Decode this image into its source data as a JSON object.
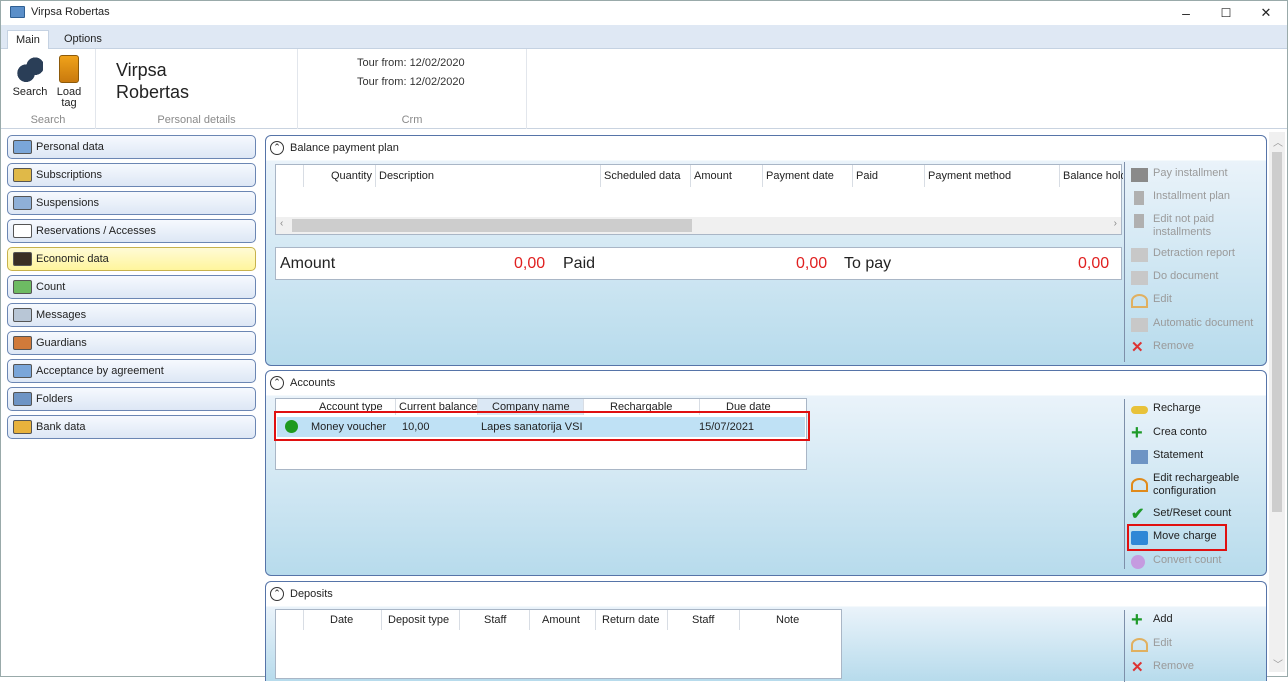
{
  "window": {
    "title": "Virpsa Robertas",
    "minimize": "–",
    "maximize": "☐",
    "close": "✕"
  },
  "tabs": [
    "Main",
    "Options"
  ],
  "ribbon": {
    "search_label": "Search",
    "load_tag_label": "Load tag",
    "search_group": "Search",
    "person_first": "Virpsa",
    "person_last": "Robertas",
    "personal_group": "Personal details",
    "tour_1": "Tour from: 12/02/2020",
    "tour_2": "Tour from: 12/02/2020",
    "crm_group": "Crm"
  },
  "nav": [
    {
      "label": "Personal data",
      "icon": "id-card-icon",
      "color": "#7aa6d9"
    },
    {
      "label": "Subscriptions",
      "icon": "tickets-icon",
      "color": "#e0b948"
    },
    {
      "label": "Suspensions",
      "icon": "pause-card-icon",
      "color": "#8fb0d8"
    },
    {
      "label": "Reservations / Accesses",
      "icon": "checklist-icon",
      "color": "#ffffff"
    },
    {
      "label": "Economic data",
      "icon": "wallet-icon",
      "color": "#3a2f24"
    },
    {
      "label": "Count",
      "icon": "money-icon",
      "color": "#6dbb63"
    },
    {
      "label": "Messages",
      "icon": "message-icon",
      "color": "#b8c6d6"
    },
    {
      "label": "Guardians",
      "icon": "people-icon",
      "color": "#d07a3a"
    },
    {
      "label": "Acceptance by agreement",
      "icon": "agreement-icon",
      "color": "#7aa6d9"
    },
    {
      "label": "Folders",
      "icon": "folders-icon",
      "color": "#6e94c4"
    },
    {
      "label": "Bank data",
      "icon": "bank-icon",
      "color": "#e8b23c"
    }
  ],
  "selected_nav": "Economic data",
  "balance": {
    "title": "Balance payment plan",
    "columns": [
      "",
      "Quantity",
      "Description",
      "Scheduled data",
      "Amount",
      "Payment date",
      "Paid",
      "Payment method",
      "Balance hold"
    ],
    "amount_label": "Amount",
    "amount_value": "0,00",
    "paid_label": "Paid",
    "paid_value": "0,00",
    "topay_label": "To pay",
    "topay_value": "0,00",
    "actions": [
      "Pay installment",
      "Installment plan",
      "Edit not paid installments",
      "Detraction report",
      "Do document",
      "Edit",
      "Automatic document",
      "Remove"
    ]
  },
  "accounts": {
    "title": "Accounts",
    "columns": [
      "Account type",
      "Current balance",
      "Company name",
      "Rechargable",
      "Due date"
    ],
    "rows": [
      {
        "status_color": "#1e9a1e",
        "type": "Money voucher",
        "balance": "10,00",
        "company": "Lapes sanatorija VSI",
        "rechargeable": "",
        "due": "15/07/2021"
      }
    ],
    "actions": [
      "Recharge",
      "Crea conto",
      "Statement",
      "Edit rechargeable configuration",
      "Set/Reset count",
      "Move charge",
      "Convert count"
    ]
  },
  "deposits": {
    "title": "Deposits",
    "columns": [
      "Date",
      "Deposit type",
      "Staff",
      "Amount",
      "Return date",
      "Staff",
      "Note"
    ],
    "actions": [
      "Add",
      "Edit",
      "Remove"
    ]
  }
}
